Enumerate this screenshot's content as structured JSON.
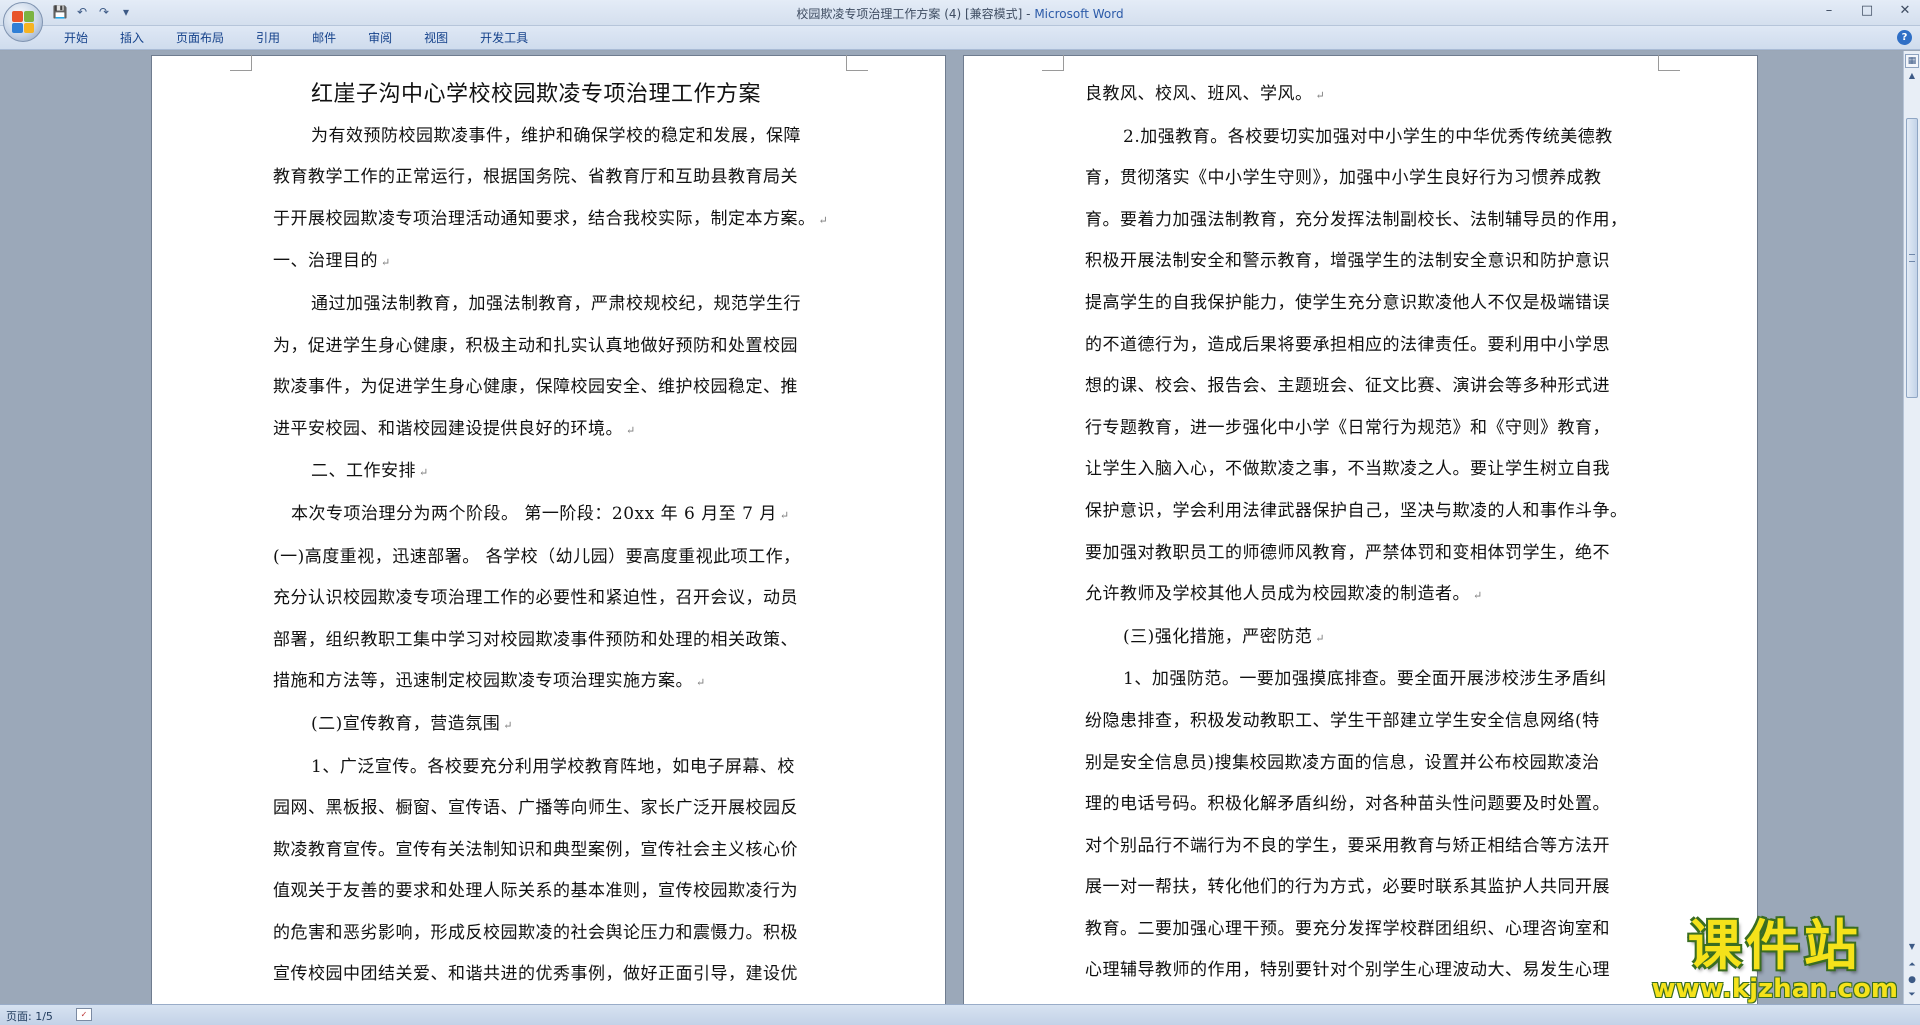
{
  "window": {
    "doc_title": "校园欺凌专项治理工作方案 (4) [兼容模式] - ",
    "app_name": "Microsoft Word",
    "min_glyph": "–",
    "max_glyph": "□",
    "close_glyph": "✕"
  },
  "quick_access": {
    "save_glyph": "💾",
    "undo_glyph": "↶",
    "redo_glyph": "↷",
    "more_glyph": "▾"
  },
  "ribbon": {
    "tabs": [
      "开始",
      "插入",
      "页面布局",
      "引用",
      "邮件",
      "审阅",
      "视图",
      "开发工具"
    ],
    "help_glyph": "?"
  },
  "document": {
    "left_page": [
      {
        "text": "红崖子沟中心学校校园欺凌专项治理工作方案",
        "style": "title"
      },
      {
        "text": "为有效预防校园欺凌事件，维护和确保学校的稳定和发展，保障",
        "style": "indent"
      },
      {
        "text": "教育教学工作的正常运行，根据国务院、省教育厅和互助县教育局关",
        "style": "plain"
      },
      {
        "text": "于开展校园欺凌专项治理活动通知要求，结合我校实际，制定本方案。",
        "style": "plain",
        "mark": "↵"
      },
      {
        "text": "一、治理目的",
        "style": "plain",
        "mark": "↵"
      },
      {
        "text": "通过加强法制教育，加强法制教育，严肃校规校纪，规范学生行",
        "style": "indent"
      },
      {
        "text": "为，促进学生身心健康，积极主动和扎实认真地做好预防和处置校园",
        "style": "plain"
      },
      {
        "text": "欺凌事件，为促进学生身心健康，保障校园安全、维护校园稳定、推",
        "style": "plain"
      },
      {
        "text": "进平安校园、和谐校园建设提供良好的环境。",
        "style": "plain",
        "mark": "↵"
      },
      {
        "text": "二、工作安排",
        "style": "indent",
        "mark": "↵"
      },
      {
        "text": "本次专项治理分为两个阶段。 第一阶段：20xx 年 6 月至 7 月",
        "style": "small",
        "mark": "↵"
      },
      {
        "text": "(一)高度重视，迅速部署。 各学校（幼儿园）要高度重视此项工作，",
        "style": "plain"
      },
      {
        "text": "充分认识校园欺凌专项治理工作的必要性和紧迫性，召开会议，动员",
        "style": "plain"
      },
      {
        "text": "部署，组织教职工集中学习对校园欺凌事件预防和处理的相关政策、",
        "style": "plain"
      },
      {
        "text": "措施和方法等，迅速制定校园欺凌专项治理实施方案。",
        "style": "plain",
        "mark": "↵"
      },
      {
        "text": "(二)宣传教育，营造氛围",
        "style": "indent",
        "mark": "↵"
      },
      {
        "text": "1、广泛宣传。各校要充分利用学校教育阵地，如电子屏幕、校",
        "style": "indent"
      },
      {
        "text": "园网、黑板报、橱窗、宣传语、广播等向师生、家长广泛开展校园反",
        "style": "plain"
      },
      {
        "text": "欺凌教育宣传。宣传有关法制知识和典型案例，宣传社会主义核心价",
        "style": "plain"
      },
      {
        "text": "值观关于友善的要求和处理人际关系的基本准则，宣传校园欺凌行为",
        "style": "plain"
      },
      {
        "text": "的危害和恶劣影响，形成反校园欺凌的社会舆论压力和震慑力。积极",
        "style": "plain"
      },
      {
        "text": "宣传校园中团结关爱、和谐共进的优秀事例，做好正面引导，建设优",
        "style": "plain"
      }
    ],
    "right_page": [
      {
        "text": "良教风、校风、班风、学风。",
        "style": "plain",
        "mark": "↵"
      },
      {
        "text": "2.加强教育。各校要切实加强对中小学生的中华优秀传统美德教",
        "style": "indent"
      },
      {
        "text": "育，贯彻落实《中小学生守则》，加强中小学生良好行为习惯养成教",
        "style": "plain"
      },
      {
        "text": "育。要着力加强法制教育，充分发挥法制副校长、法制辅导员的作用，",
        "style": "plain"
      },
      {
        "text": "积极开展法制安全和警示教育，增强学生的法制安全意识和防护意识",
        "style": "plain"
      },
      {
        "text": "提高学生的自我保护能力，使学生充分意识欺凌他人不仅是极端错误",
        "style": "plain"
      },
      {
        "text": "的不道德行为，造成后果将要承担相应的法律责任。要利用中小学思",
        "style": "plain"
      },
      {
        "text": "想的课、校会、报告会、主题班会、征文比赛、演讲会等多种形式进",
        "style": "plain"
      },
      {
        "text": "行专题教育，进一步强化中小学《日常行为规范》和《守则》教育，",
        "style": "plain"
      },
      {
        "text": "让学生入脑入心，不做欺凌之事，不当欺凌之人。要让学生树立自我",
        "style": "plain"
      },
      {
        "text": "保护意识，学会利用法律武器保护自己，坚决与欺凌的人和事作斗争。",
        "style": "plain"
      },
      {
        "text": "要加强对教职员工的师德师风教育，严禁体罚和变相体罚学生，绝不",
        "style": "plain"
      },
      {
        "text": "允许教师及学校其他人员成为校园欺凌的制造者。",
        "style": "plain",
        "mark": "↵"
      },
      {
        "text": "(三)强化措施，严密防范",
        "style": "indent",
        "mark": "↵"
      },
      {
        "text": "1、加强防范。一要加强摸底排查。要全面开展涉校涉生矛盾纠",
        "style": "indent"
      },
      {
        "text": "纷隐患排查，积极发动教职工、学生干部建立学生安全信息网络(特",
        "style": "plain"
      },
      {
        "text": "别是安全信息员)搜集校园欺凌方面的信息，设置并公布校园欺凌治",
        "style": "plain"
      },
      {
        "text": "理的电话号码。积极化解矛盾纠纷，对各种苗头性问题要及时处置。",
        "style": "plain"
      },
      {
        "text": "对个别品行不端行为不良的学生，要采用教育与矫正相结合等方法开",
        "style": "plain"
      },
      {
        "text": "展一对一帮扶，转化他们的行为方式，必要时联系其监护人共同开展",
        "style": "plain"
      },
      {
        "text": "教育。二要加强心理干预。要充分发挥学校群团组织、心理咨询室和",
        "style": "plain"
      },
      {
        "text": "心理辅导教师的作用，特别要针对个别学生心理波动大、易发生心理",
        "style": "plain"
      }
    ]
  },
  "statusbar": {
    "page_info": "页面: 1/5"
  },
  "watermark": {
    "main": "课件站",
    "url": "www.kjzhan.com"
  },
  "colors": {
    "workspace_bg": "#9ba8b9",
    "ribbon_tab_text": "#15428b",
    "watermark_fill": "#f5e21a",
    "watermark_outline": "#3a6d22"
  }
}
